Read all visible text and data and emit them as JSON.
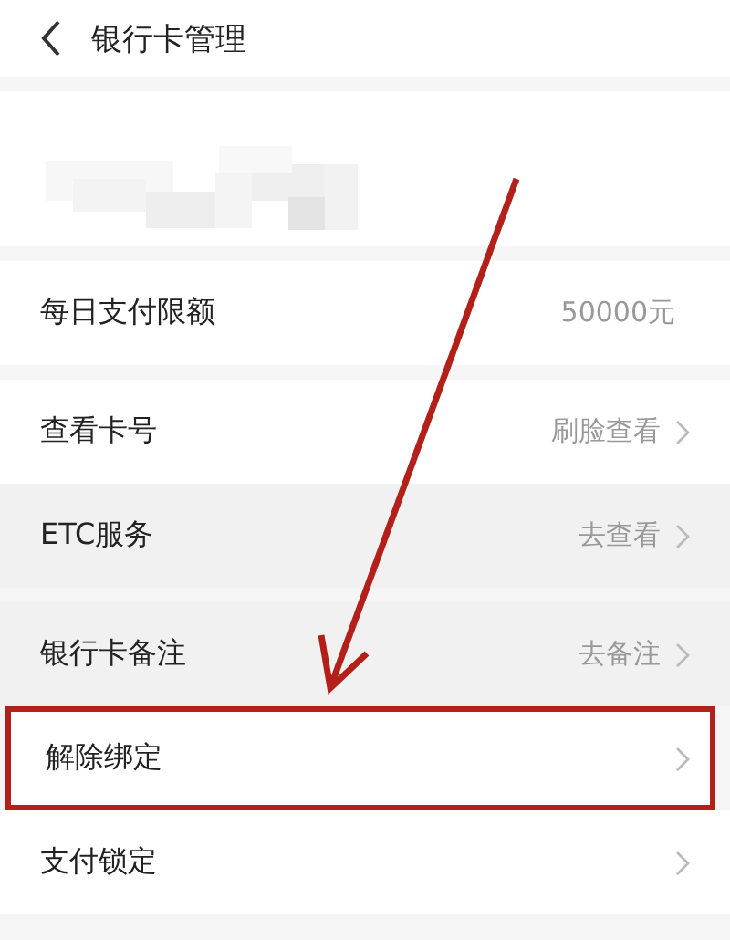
{
  "header": {
    "title": "银行卡管理"
  },
  "groups": [
    {
      "rows": [
        {
          "label": "每日支付限额",
          "value": "50000元",
          "chevron": false,
          "shaded": false,
          "highlighted": false
        }
      ]
    },
    {
      "rows": [
        {
          "label": "查看卡号",
          "value": "刷脸查看",
          "chevron": true,
          "shaded": false,
          "highlighted": false
        },
        {
          "label": "ETC服务",
          "value": "去查看",
          "chevron": true,
          "shaded": true,
          "highlighted": false
        }
      ]
    },
    {
      "rows": [
        {
          "label": "银行卡备注",
          "value": "去备注",
          "chevron": true,
          "shaded": true,
          "highlighted": false
        },
        {
          "label": "解除绑定",
          "chevron": true,
          "shaded": false,
          "highlighted": true
        },
        {
          "label": "支付锁定",
          "chevron": true,
          "shaded": false,
          "highlighted": false
        }
      ]
    }
  ]
}
